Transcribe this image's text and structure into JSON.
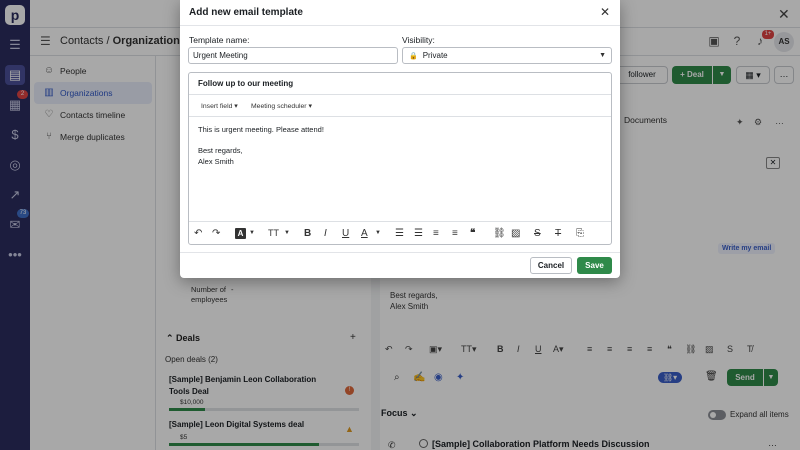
{
  "app": {
    "logo_letter": "p",
    "accent_color": "#2f8a4a",
    "rail_color": "#2b2d5f",
    "rail_badges": [
      "2",
      "73"
    ]
  },
  "header": {
    "breadcrumb_root": "Contacts",
    "breadcrumb_separator": "/",
    "breadcrumb_current": "Organizations",
    "notification_badge": "1+",
    "avatar_initials": "AS"
  },
  "sidebar": {
    "items": [
      {
        "label": "People",
        "icon": "person-icon"
      },
      {
        "label": "Organizations",
        "icon": "building-icon",
        "active": true
      },
      {
        "label": "Contacts timeline",
        "icon": "heartbeat-icon"
      },
      {
        "label": "Merge duplicates",
        "icon": "merge-icon"
      }
    ]
  },
  "background": {
    "follower_label": "follower",
    "deal_label": "+ Deal",
    "documents_tab": "Documents",
    "number_of_employees_label": "Number of\nemployees",
    "number_of_employees_value": "-",
    "write_email_label": "Write my email",
    "signature_line1": "Best regards,",
    "signature_line2": "Alex Smith",
    "deals_title": "Deals",
    "open_deals_label": "Open deals (2)",
    "deals": [
      {
        "name": "[Sample] Benjamin Leon Collaboration Tools Deal",
        "value": "$10,000"
      },
      {
        "name": "[Sample] Leon Digital Systems deal",
        "value": "$5"
      }
    ],
    "send_label": "Send",
    "focus_label": "Focus",
    "expand_all_label": "Expand all items",
    "activity_title": "[Sample] Collaboration Platform Needs Discussion"
  },
  "modal": {
    "title": "Add new email template",
    "template_name_label": "Template name:",
    "template_name_value": "Urgent Meeting",
    "visibility_label": "Visibility:",
    "visibility_value": "Private",
    "subject": "Follow up to our meeting",
    "insert_field_label": "Insert field",
    "meeting_scheduler_label": "Meeting scheduler",
    "body_lines": [
      "This is urgent meeting. Please attend!",
      "",
      "Best regards,",
      "Alex Smith"
    ],
    "cancel_label": "Cancel",
    "save_label": "Save"
  }
}
